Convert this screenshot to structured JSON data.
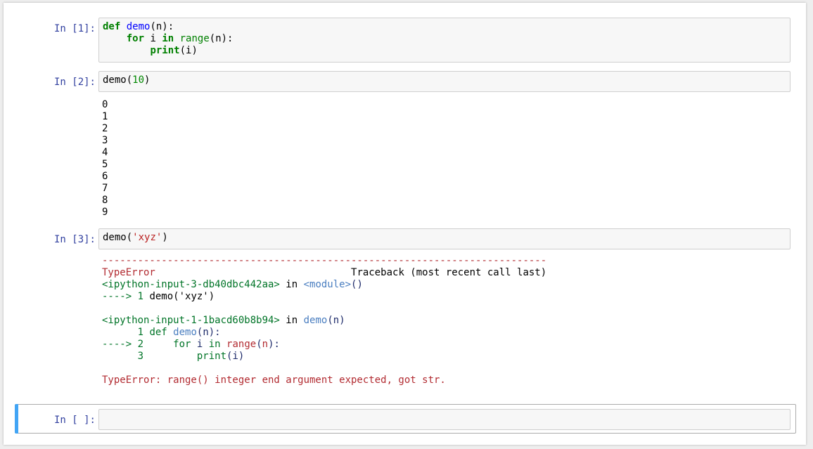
{
  "cells": [
    {
      "prompt": "In [1]:",
      "code_lines": [
        {
          "kw1": "def",
          "fn": "demo",
          "rest": "(n):"
        },
        {
          "indent": "    ",
          "kw1": "for",
          "mid": " i ",
          "kw2": "in",
          "sp": " ",
          "bi": "range",
          "rest": "(n):"
        },
        {
          "indent": "        ",
          "kw1": "print",
          "rest": "(i)"
        }
      ]
    },
    {
      "prompt": "In [2]:",
      "code": {
        "fn": "demo",
        "open": "(",
        "arg": "10",
        "close": ")"
      },
      "output_lines": [
        "0",
        "1",
        "2",
        "3",
        "4",
        "5",
        "6",
        "7",
        "8",
        "9"
      ]
    },
    {
      "prompt": "In [3]:",
      "code": {
        "fn": "demo",
        "open": "(",
        "arg": "'xyz'",
        "close": ")"
      },
      "traceback": {
        "separator": "---------------------------------------------------------------------------",
        "error_name": "TypeError",
        "header_right": "Traceback (most recent call last)",
        "frame1_file": "<ipython-input-3-db40dbc442aa>",
        "frame1_in": " in ",
        "frame1_module": "<module>",
        "frame1_parens": "()",
        "frame1_arrow": "----> 1 ",
        "frame1_code": "demo('xyz')",
        "frame2_file": "<ipython-input-1-1bacd60b8b94>",
        "frame2_in": " in ",
        "frame2_func": "demo",
        "frame2_open": "(",
        "frame2_arg": "n",
        "frame2_close": ")",
        "line1_num": "      1 ",
        "line1_kw": "def",
        "line1_sp": " ",
        "line1_fn": "demo",
        "line1_rest": "(n):",
        "line2_arrow": "----> 2 ",
        "line2_indent": "    ",
        "line2_kw": "for",
        "line2_mid": " i ",
        "line2_in": "in",
        "line2_sp": " ",
        "line2_range": "range",
        "line2_open": "(",
        "line2_arg": "n",
        "line2_close": "):",
        "line3_num": "      3 ",
        "line3_indent": "        ",
        "line3_print": "print",
        "line3_open": "(",
        "line3_arg": "i",
        "line3_close": ")",
        "final_error": "TypeError: range() integer end argument expected, got str."
      }
    },
    {
      "prompt": "In [ ]:"
    }
  ],
  "colors": {
    "prompt": "#303f9f",
    "selected_bar": "#42a5f5"
  }
}
